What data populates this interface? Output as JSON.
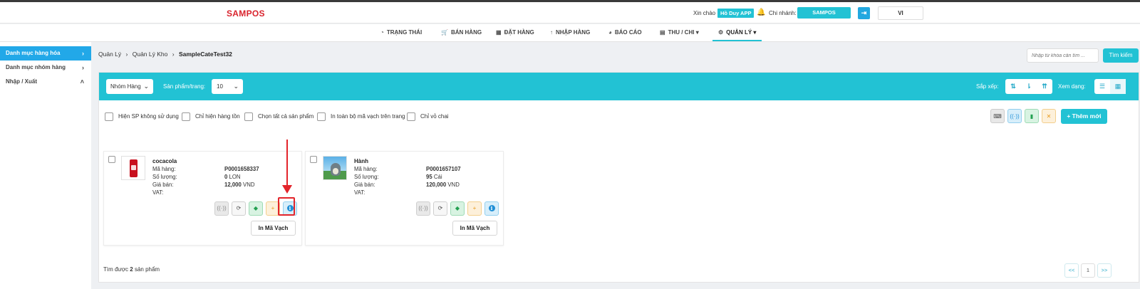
{
  "header": {
    "logo": "SAMPOS",
    "greeting": "Xin chào",
    "user": "Hồ Duy APP",
    "branch_label": "Chi nhánh:",
    "branch_value": "SAMPOS",
    "logout_icon": "sign-out-icon",
    "language": "VI"
  },
  "nav": {
    "items": [
      {
        "label": "TRẠNG THÁI",
        "icon": "dashboard-icon"
      },
      {
        "label": "BÁN HÀNG",
        "icon": "cart-icon"
      },
      {
        "label": "ĐẶT HÀNG",
        "icon": "calendar-icon"
      },
      {
        "label": "NHẬP HÀNG",
        "icon": "arrow-up-icon"
      },
      {
        "label": "BÁO CÁO",
        "icon": "pie-chart-icon"
      },
      {
        "label": "THU / CHI",
        "icon": "money-icon"
      },
      {
        "label": "QUẢN LÝ",
        "icon": "gear-icon"
      }
    ],
    "active": "QUẢN LÝ"
  },
  "sidebar": {
    "items": [
      {
        "label": "Danh mục hàng hóa",
        "chevron": "›"
      },
      {
        "label": "Danh mục nhóm hàng",
        "chevron": "›"
      },
      {
        "label": "Nhập / Xuất",
        "chevron": "˄"
      }
    ],
    "active_index": 0
  },
  "breadcrumb": {
    "items": [
      "Quản Lý",
      "Quản Lý Kho",
      "SampleCateTest32"
    ],
    "separator": "›"
  },
  "search": {
    "placeholder": "Nhập từ khóa cần tìm ...",
    "button": "Tìm kiếm"
  },
  "toolbar": {
    "group_select": "Nhóm Hàng",
    "per_page_label": "Sản phẩm/trang:",
    "per_page_value": "10",
    "sort_label": "Sắp xếp:",
    "view_label": "Xem dạng:",
    "active_view": "grid"
  },
  "filters": [
    "Hiện SP không sử dụng",
    "Chỉ hiện hàng tồn",
    "Chọn tất cả sản phẩm",
    "In toàn bộ mã vạch trên trang",
    "Chỉ vỏ chai"
  ],
  "actions": {
    "add_button": "+ Thêm mới"
  },
  "field_labels": {
    "code": "Mã hàng:",
    "quantity": "Số lượng:",
    "price": "Giá bán:",
    "vat": "VAT:"
  },
  "products": [
    {
      "name": "cocacola",
      "code": "P0001658337",
      "quantity": "0",
      "unit": "LON",
      "price": "12,000",
      "currency": "VND",
      "vat": "",
      "image": "coca-cola-can"
    },
    {
      "name": "Hành",
      "code": "P0001657107",
      "quantity": "95",
      "unit": "Cái",
      "price": "120,000",
      "currency": "VND",
      "vat": "",
      "image": "totoro-scene"
    }
  ],
  "card_buttons": {
    "barcode": "In Mã Vạch"
  },
  "footer": {
    "found_prefix": "Tìm được ",
    "found_count": "2",
    "found_suffix": " sản phẩm",
    "pages": [
      "<<",
      "1",
      ">>"
    ]
  },
  "colors": {
    "accent": "#22c2d4",
    "sidebar_active": "#22a8e8",
    "logo": "#d9232d",
    "annotation": "#e3242b"
  }
}
